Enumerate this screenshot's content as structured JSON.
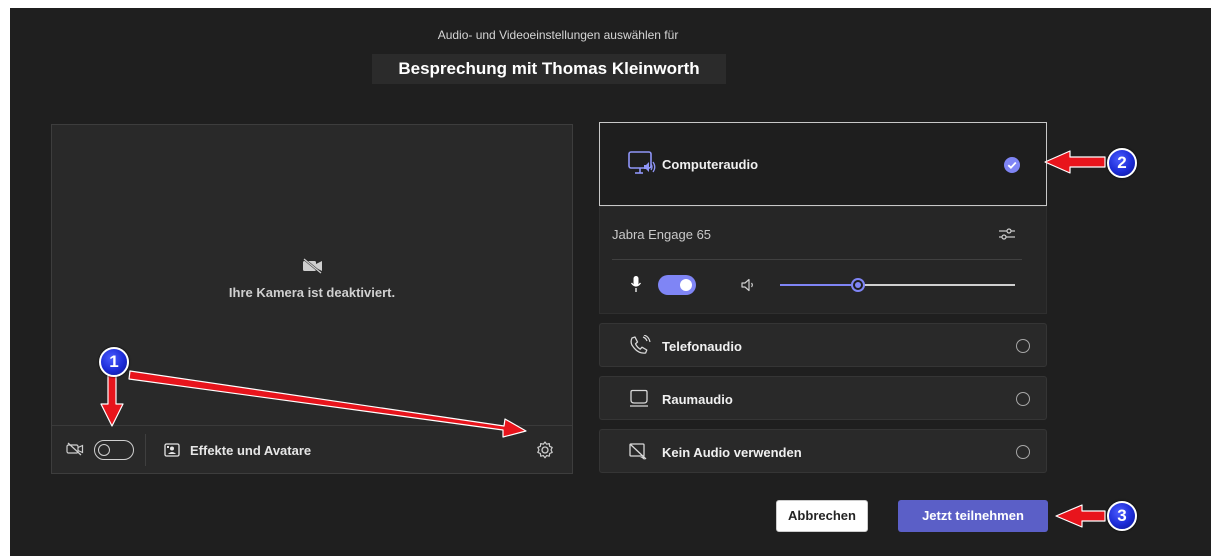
{
  "header": {
    "subtitle": "Audio- und Videoeinstellungen auswählen für",
    "meeting_title": "Besprechung mit Thomas Kleinworth"
  },
  "camera": {
    "disabled_text": "Ihre Kamera ist deaktiviert.",
    "camera_toggle_on": false,
    "effects_label": "Effekte und Avatare"
  },
  "audio": {
    "options": [
      {
        "label": "Computeraudio",
        "icon": "computer-audio-icon",
        "selected": true
      },
      {
        "label": "Telefonaudio",
        "icon": "phone-audio-icon",
        "selected": false
      },
      {
        "label": "Raumaudio",
        "icon": "room-audio-icon",
        "selected": false
      },
      {
        "label": "Kein Audio verwenden",
        "icon": "no-audio-icon",
        "selected": false
      }
    ],
    "device_name": "Jabra Engage 65",
    "mic_on": true,
    "speaker_volume": 0.33
  },
  "buttons": {
    "cancel": "Abbrechen",
    "join": "Jetzt teilnehmen"
  },
  "callouts": [
    "1",
    "2",
    "3"
  ],
  "colors": {
    "background": "#1f1f1f",
    "accent": "#7f85f5",
    "join_button": "#5b5fc7",
    "arrow": "#e8141c",
    "badge": "#1c2bd6"
  }
}
